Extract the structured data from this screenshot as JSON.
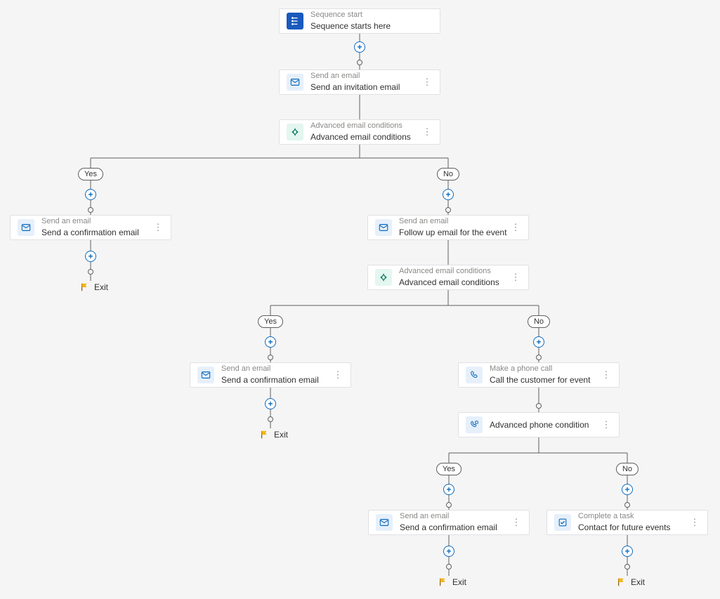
{
  "labels": {
    "yes": "Yes",
    "no": "No",
    "exit": "Exit"
  },
  "nodes": {
    "start": {
      "sub": "Sequence start",
      "title": "Sequence starts here"
    },
    "invite_email": {
      "sub": "Send an email",
      "title": "Send an invitation email"
    },
    "cond1": {
      "sub": "Advanced email conditions",
      "title": "Advanced email conditions"
    },
    "confirm_email_a": {
      "sub": "Send an email",
      "title": "Send a confirmation email"
    },
    "followup_email": {
      "sub": "Send an email",
      "title": "Follow up email for the event"
    },
    "cond2": {
      "sub": "Advanced email conditions",
      "title": "Advanced email conditions"
    },
    "confirm_email_b": {
      "sub": "Send an email",
      "title": "Send a confirmation email"
    },
    "call": {
      "sub": "Make a phone call",
      "title": "Call the customer for event"
    },
    "phone_cond": {
      "title": "Advanced phone condition"
    },
    "confirm_email_c": {
      "sub": "Send an email",
      "title": "Send a confirmation email"
    },
    "future_task": {
      "sub": "Complete a task",
      "title": "Contact for future events"
    }
  }
}
